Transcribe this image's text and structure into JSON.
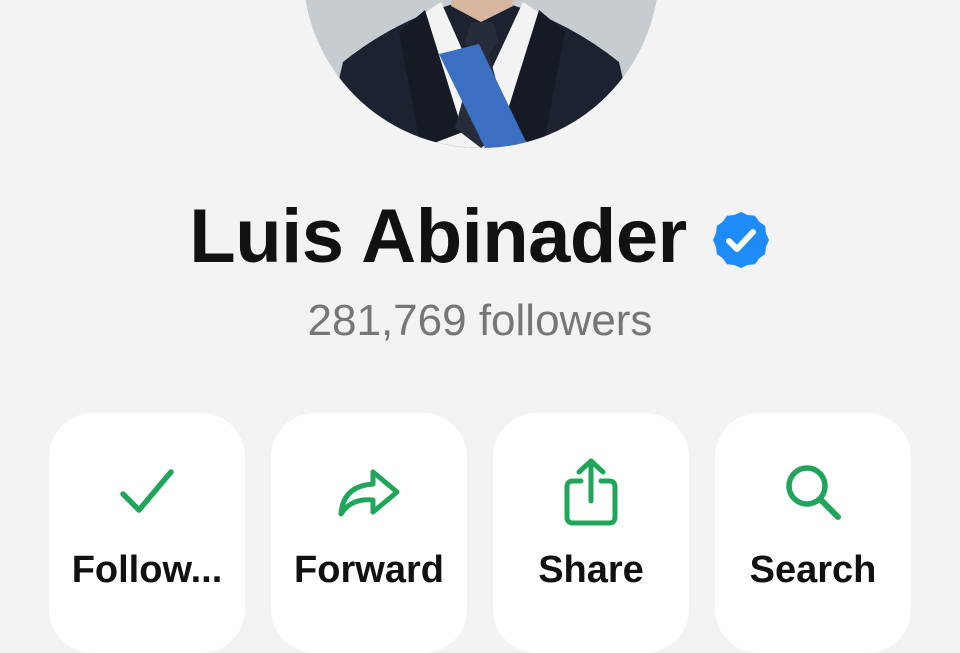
{
  "profile": {
    "name": "Luis Abinader",
    "followers": "281,769 followers",
    "verified": true
  },
  "actions": [
    {
      "label": "Follow...",
      "icon": "checkmark-icon"
    },
    {
      "label": "Forward",
      "icon": "forward-arrow-icon"
    },
    {
      "label": "Share",
      "icon": "share-icon"
    },
    {
      "label": "Search",
      "icon": "search-icon"
    }
  ],
  "colors": {
    "background": "#f3f3f3",
    "accent_green": "#1fa65a",
    "verified_blue": "#1d8cf8",
    "name_text": "#111111",
    "followers_text": "#767676",
    "button_bg": "#ffffff"
  }
}
